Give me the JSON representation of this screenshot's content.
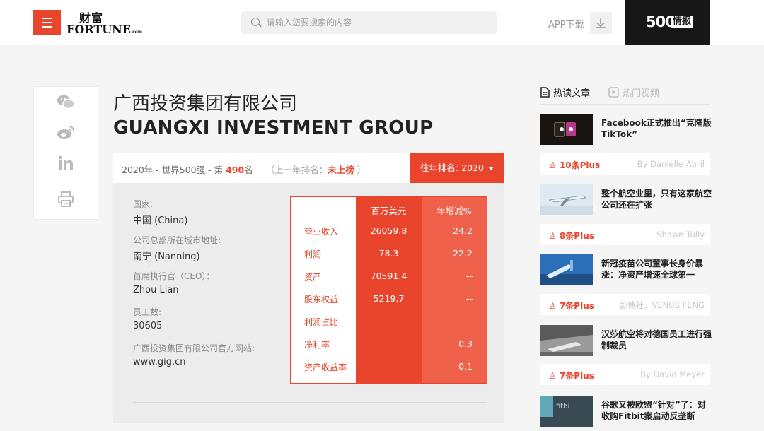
{
  "header": {
    "logo_cn": "财富",
    "logo_en": "FORTUNE",
    "logo_en_small": ".com",
    "search_placeholder": "请输入您要搜索的内容",
    "app_download": "APP下载",
    "f500_num": "500",
    "f500_tag": "情报"
  },
  "company": {
    "name_cn": "广西投资集团有限公司",
    "name_en": "GUANGXI INVESTMENT GROUP"
  },
  "rank": {
    "year_prefix": "2020年 - 世界500强 - 第 ",
    "rank": "490",
    "rank_suffix": "名",
    "prev_label": "（上一年排名：",
    "prev_value": "未上榜",
    "prev_close": " ）",
    "history_button": "往年排名: 2020"
  },
  "info": [
    {
      "label": "国家:",
      "value": "中国 (China)"
    },
    {
      "label": "公司总部所在城市地址:",
      "value": "南宁 (Nanning)"
    },
    {
      "label": "首席执行官（CEO）：",
      "value": "Zhou Lian"
    },
    {
      "label": "员工数:",
      "value": "30605"
    },
    {
      "label": "广西投资集团有限公司官方网站:",
      "value": "www.gig.cn"
    }
  ],
  "financials": {
    "col1": "百万美元",
    "col2": "年增减%",
    "rows": [
      {
        "label": "营业收入",
        "value": "26059.8",
        "change": "24.2"
      },
      {
        "label": "利润",
        "value": "78.3",
        "change": "-22.2"
      },
      {
        "label": "资产",
        "value": "70591.4",
        "change": "--"
      },
      {
        "label": "股东权益",
        "value": "5219.7",
        "change": "--"
      },
      {
        "label": "利润占比",
        "value": "",
        "change": ""
      },
      {
        "label": "净利率",
        "value": "",
        "change": "0.3"
      },
      {
        "label": "资产收益率",
        "value": "",
        "change": "0.1"
      }
    ]
  },
  "sidebar": {
    "tab_articles": "热读文章",
    "tab_videos": "热门视频",
    "articles": [
      {
        "title": "Facebook正式推出“克隆版TikTok”",
        "plus": "10条Plus",
        "author": "By Danielle Abril"
      },
      {
        "title": "整个航空业里，只有这家航空公司还在扩张",
        "plus": "8条Plus",
        "author": "Shawn Tully"
      },
      {
        "title": "新冠疫苗公司董事长身价暴涨：净资产增速全球第一",
        "plus": "7条Plus",
        "author": "彭博社，VENUS FENG"
      },
      {
        "title": "汉莎航空将对德国员工进行强制裁员",
        "plus": "7条Plus",
        "author": "By David Meyer"
      },
      {
        "title": "谷歌又被欧盟“针对”了：对收购Fitbit案启动反垄断",
        "plus": "",
        "author": ""
      }
    ]
  }
}
